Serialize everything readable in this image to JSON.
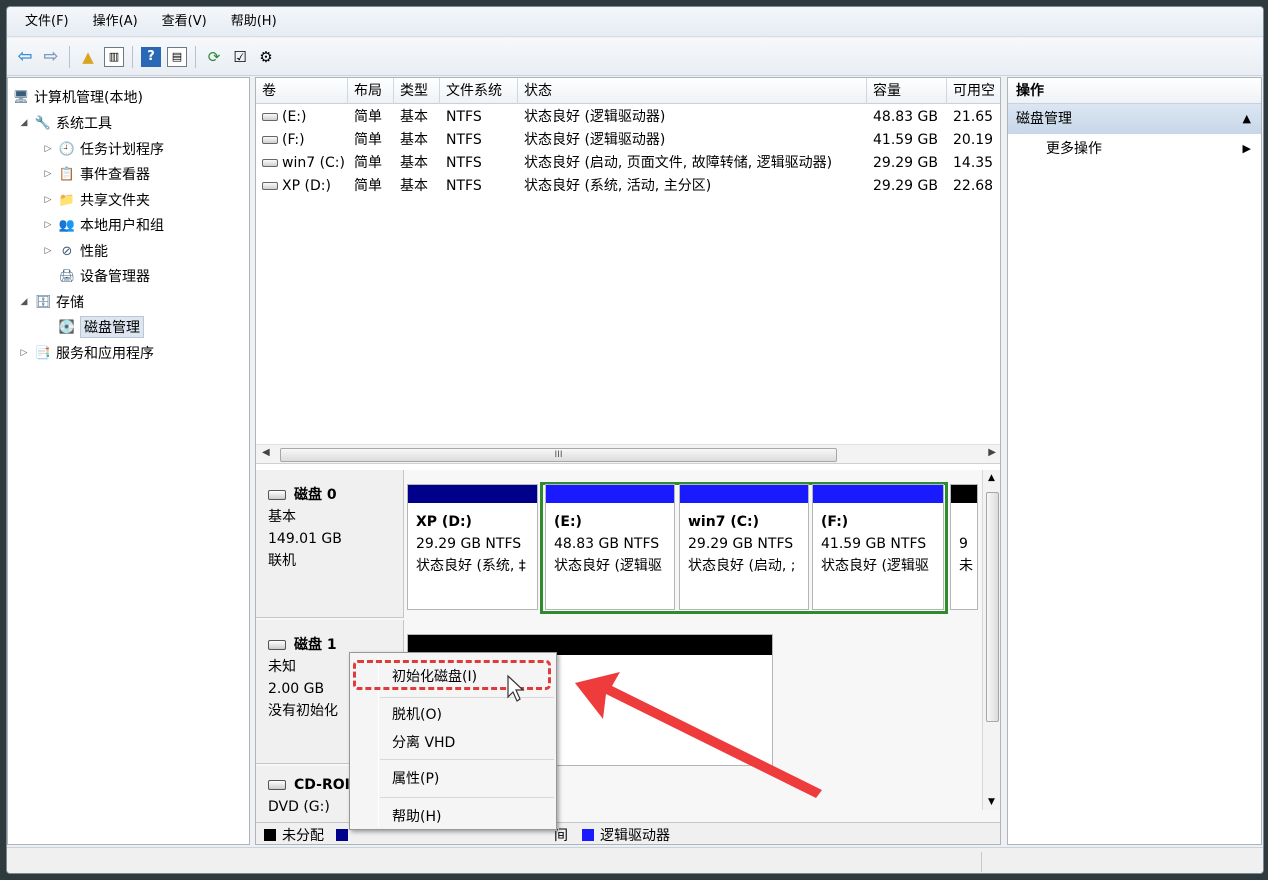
{
  "menubar": [
    "文件(F)",
    "操作(A)",
    "查看(V)",
    "帮助(H)"
  ],
  "tree": {
    "root": "计算机管理(本地)",
    "system_tools": "系统工具",
    "task_scheduler": "任务计划程序",
    "event_viewer": "事件查看器",
    "shared_folders": "共享文件夹",
    "local_users": "本地用户和组",
    "performance": "性能",
    "device_manager": "设备管理器",
    "storage": "存储",
    "disk_management": "磁盘管理",
    "services_apps": "服务和应用程序"
  },
  "volume_table": {
    "columns": [
      "卷",
      "布局",
      "类型",
      "文件系统",
      "状态",
      "容量",
      "可用空"
    ],
    "rows": [
      [
        "(E:)",
        "简单",
        "基本",
        "NTFS",
        "状态良好 (逻辑驱动器)",
        "48.83 GB",
        "21.65"
      ],
      [
        "(F:)",
        "简单",
        "基本",
        "NTFS",
        "状态良好 (逻辑驱动器)",
        "41.59 GB",
        "20.19"
      ],
      [
        "win7 (C:)",
        "简单",
        "基本",
        "NTFS",
        "状态良好 (启动, 页面文件, 故障转储, 逻辑驱动器)",
        "29.29 GB",
        "14.35"
      ],
      [
        "XP (D:)",
        "简单",
        "基本",
        "NTFS",
        "状态良好 (系统, 活动, 主分区)",
        "29.29 GB",
        "22.68"
      ]
    ],
    "scroll_thumb": "III"
  },
  "disk0": {
    "name": "磁盘 0",
    "type": "基本",
    "size": "149.01 GB",
    "status": "联机",
    "partitions": [
      {
        "title": "XP  (D:)",
        "size": "29.29 GB NTFS",
        "status": "状态良好 (系统, ‡"
      },
      {
        "title": "(E:)",
        "size": "48.83 GB NTFS",
        "status": "状态良好 (逻辑驱"
      },
      {
        "title": "win7  (C:)",
        "size": "29.29 GB NTFS",
        "status": "状态良好 (启动, ;"
      },
      {
        "title": "(F:)",
        "size": "41.59 GB NTFS",
        "status": "状态良好 (逻辑驱"
      },
      {
        "title": "",
        "size": "9",
        "status": "未"
      }
    ]
  },
  "disk1": {
    "name": "磁盘 1",
    "type": "未知",
    "size": "2.00 GB",
    "status": "没有初始化"
  },
  "cdrom": {
    "name": "CD-ROI",
    "drive": "DVD (G:)"
  },
  "legend": {
    "unallocated": "未分配",
    "partial": "间",
    "logical": "逻辑驱动器"
  },
  "actions": {
    "title": "操作",
    "section": "磁盘管理",
    "more": "更多操作"
  },
  "context_menu": {
    "initialize": "初始化磁盘(I)",
    "offline": "脱机(O)",
    "detach_vhd": "分离 VHD",
    "properties": "属性(P)",
    "help": "帮助(H)"
  },
  "colors": {
    "primary_partition": "#00008b",
    "logical_drive": "#1a1aff",
    "unallocated": "#000000",
    "extended_border": "#2e8b2e",
    "annotation_red": "#e03a3a"
  }
}
